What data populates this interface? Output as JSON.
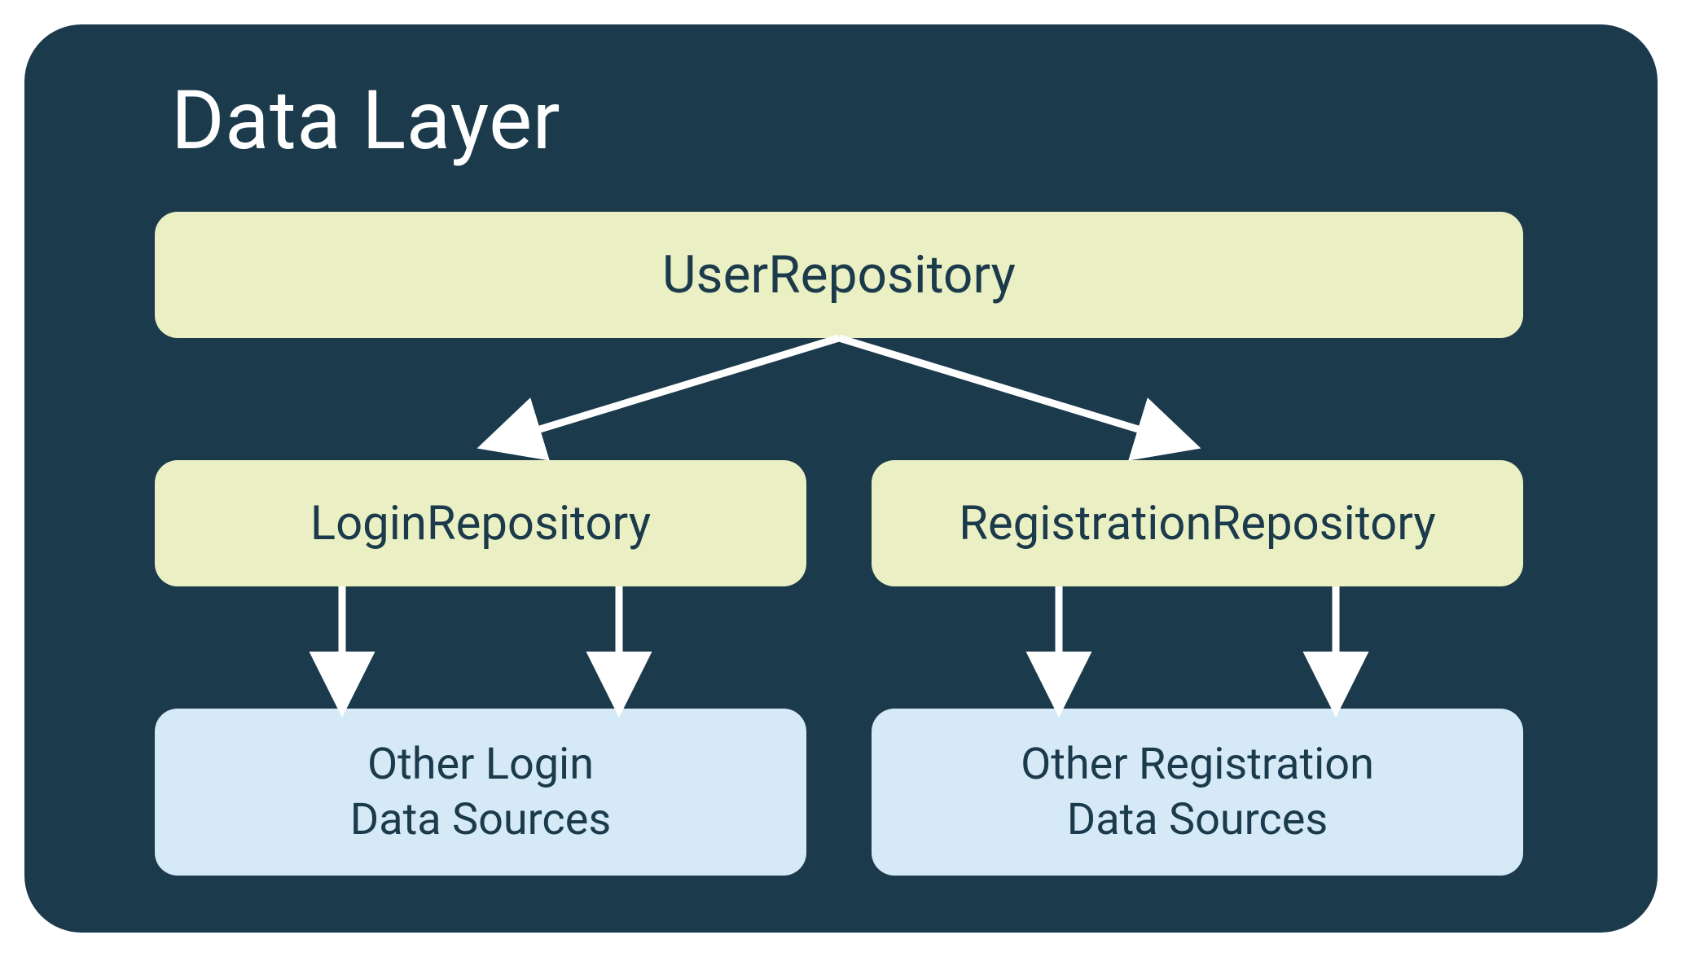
{
  "title": "Data Layer",
  "user_repo": "UserRepository",
  "login_repo": "LoginRepository",
  "registration_repo": "RegistrationRepository",
  "login_ds_line1": "Other Login",
  "login_ds_line2": "Data Sources",
  "reg_ds_line1": "Other Registration",
  "reg_ds_line2": "Data Sources",
  "colors": {
    "panel_bg": "#1b3a4b",
    "repo_bg": "#eaf0c3",
    "datasource_bg": "#d5e9f7",
    "arrow": "#ffffff"
  }
}
